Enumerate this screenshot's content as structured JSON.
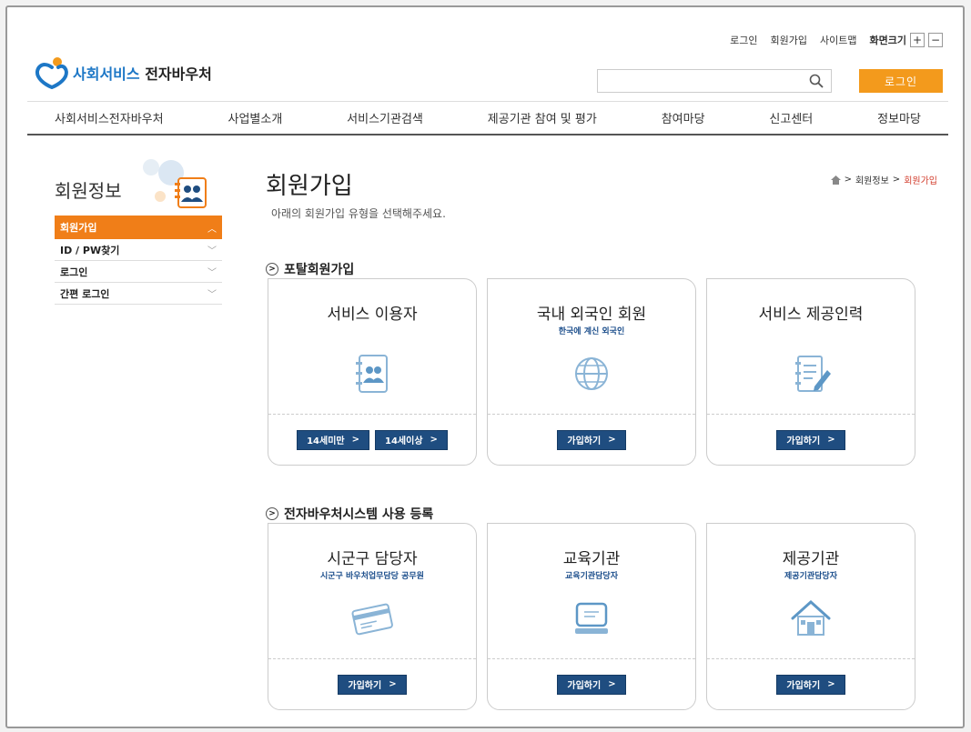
{
  "util": {
    "login": "로그인",
    "join": "회원가입",
    "sitemap": "사이트맵",
    "zoom_label": "화면크기",
    "zoom_in": "+",
    "zoom_out": "−"
  },
  "logo": {
    "part_a": "사회서비스",
    "part_b": "전자바우처"
  },
  "search": {
    "placeholder": ""
  },
  "login_button": "로그인",
  "nav": [
    "사회서비스전자바우처",
    "사업별소개",
    "서비스기관검색",
    "제공기관 참여 및 평가",
    "참여마당",
    "신고센터",
    "정보마당"
  ],
  "sidebar": {
    "title": "회원정보",
    "items": [
      {
        "label": "회원가입",
        "chev": "︿"
      },
      {
        "label": "ID / PW찾기",
        "chev": "﹀"
      },
      {
        "label": "로그인",
        "chev": "﹀"
      },
      {
        "label": "간편 로그인",
        "chev": "﹀"
      }
    ]
  },
  "page": {
    "title": "회원가입",
    "subtitle": "아래의 회원가입 유형을 선택해주세요.",
    "breadcrumb": {
      "sep": ">",
      "level1": "회원정보",
      "current": "회원가입"
    }
  },
  "sections": [
    {
      "title": "포탈회원가입",
      "cards": [
        {
          "title": "서비스 이용자",
          "sub": "",
          "icon": "address-book-icon",
          "buttons": [
            "14세미만",
            "14세이상"
          ]
        },
        {
          "title": "국내 외국인 회원",
          "sub": "한국에 계신 외국인",
          "icon": "globe-icon",
          "buttons": [
            "가입하기"
          ]
        },
        {
          "title": "서비스 제공인력",
          "sub": "",
          "icon": "document-edit-icon",
          "buttons": [
            "가입하기"
          ]
        }
      ]
    },
    {
      "title": "전자바우처시스템 사용 등록",
      "cards": [
        {
          "title": "시군구 담당자",
          "sub": "시군구 바우처업무담당 공무원",
          "icon": "card-icon",
          "buttons": [
            "가입하기"
          ]
        },
        {
          "title": "교육기관",
          "sub": "교육기관담당자",
          "icon": "monitor-icon",
          "buttons": [
            "가입하기"
          ]
        },
        {
          "title": "제공기관",
          "sub": "제공기관담당자",
          "icon": "house-icon",
          "buttons": [
            "가입하기"
          ]
        }
      ]
    }
  ],
  "arrow": ">",
  "colors": {
    "accent": "#f07e18",
    "brand": "#1d77c6",
    "button": "#1f4d80",
    "breadcrumb_current": "#d23c2c"
  }
}
